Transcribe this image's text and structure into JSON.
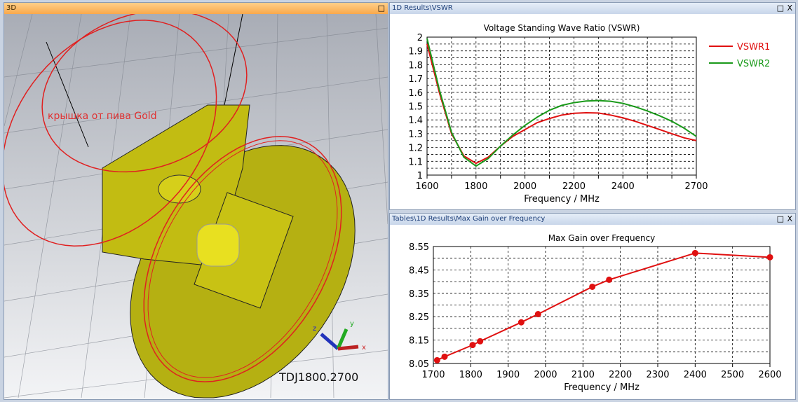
{
  "panels": {
    "view3d": {
      "title": "3D",
      "annotation": "крышка от пива Gold",
      "model_label": "TDJ1800.2700",
      "axes": {
        "x": "x",
        "y": "y",
        "z": "z"
      }
    },
    "vswr": {
      "title": "1D Results\\VSWR"
    },
    "gain": {
      "title": "Tables\\1D Results\\Max Gain over Frequency"
    }
  },
  "icons": {
    "maximize": "□",
    "close": "X"
  },
  "chart_data": [
    {
      "type": "line",
      "title": "Voltage Standing Wave Ratio (VSWR)",
      "xlabel": "Frequency / MHz",
      "ylabel": "",
      "xlim": [
        1600,
        2700
      ],
      "ylim": [
        1,
        2
      ],
      "xticks": [
        1600,
        1800,
        2000,
        2200,
        2400,
        2700
      ],
      "yticks": [
        1,
        1.1,
        1.2,
        1.3,
        1.4,
        1.5,
        1.6,
        1.7,
        1.8,
        1.9,
        2
      ],
      "grid": true,
      "legend": "right",
      "x": [
        1600,
        1650,
        1700,
        1750,
        1800,
        1850,
        1900,
        1950,
        2000,
        2050,
        2100,
        2150,
        2200,
        2250,
        2300,
        2350,
        2400,
        2450,
        2500,
        2550,
        2600,
        2650,
        2700
      ],
      "series": [
        {
          "name": "VSWR1",
          "color": "#e01010",
          "values": [
            1.95,
            1.6,
            1.3,
            1.14,
            1.085,
            1.13,
            1.21,
            1.28,
            1.33,
            1.38,
            1.41,
            1.435,
            1.448,
            1.452,
            1.45,
            1.435,
            1.415,
            1.39,
            1.36,
            1.33,
            1.3,
            1.27,
            1.25
          ]
        },
        {
          "name": "VSWR2",
          "color": "#1a9a1a",
          "values": [
            1.99,
            1.62,
            1.31,
            1.13,
            1.065,
            1.12,
            1.21,
            1.29,
            1.36,
            1.42,
            1.47,
            1.505,
            1.525,
            1.537,
            1.54,
            1.535,
            1.52,
            1.495,
            1.465,
            1.43,
            1.39,
            1.34,
            1.28
          ]
        }
      ]
    },
    {
      "type": "line",
      "title": "Max Gain over Frequency",
      "xlabel": "Frequency / MHz",
      "ylabel": "",
      "xlim": [
        1700,
        2600
      ],
      "ylim": [
        8.05,
        8.55
      ],
      "xticks": [
        1700,
        1800,
        1900,
        2000,
        2100,
        2200,
        2300,
        2400,
        2500,
        2600
      ],
      "yticks": [
        8.05,
        8.15,
        8.25,
        8.35,
        8.45,
        8.55
      ],
      "grid": true,
      "series": [
        {
          "name": "Max Gain",
          "color": "#e01010",
          "x": [
            1710,
            1730,
            1805,
            1825,
            1935,
            1980,
            2125,
            2170,
            2400,
            2600
          ],
          "values": [
            8.064,
            8.079,
            8.129,
            8.145,
            8.226,
            8.261,
            8.378,
            8.408,
            8.522,
            8.504
          ]
        }
      ]
    }
  ]
}
